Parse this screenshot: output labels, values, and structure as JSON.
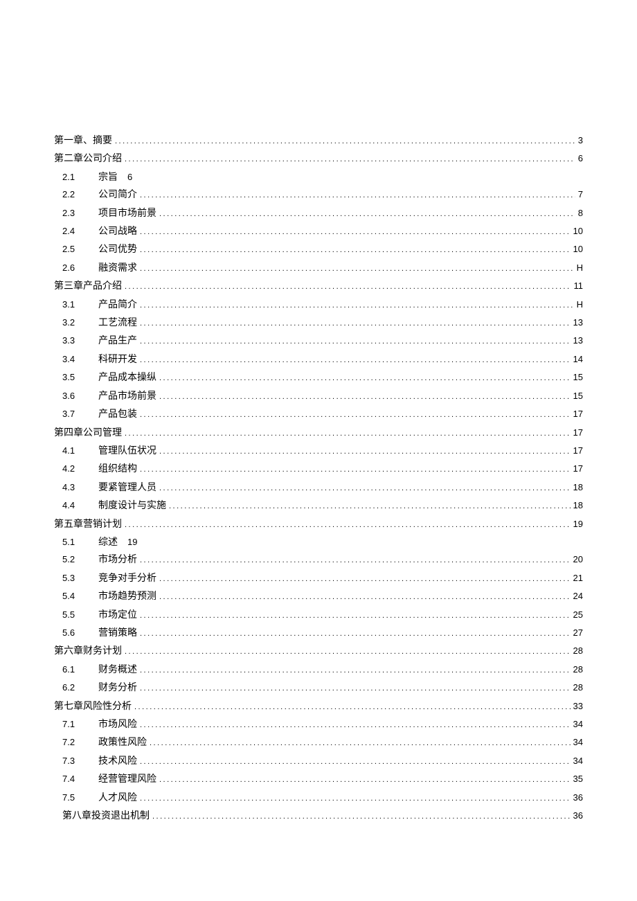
{
  "toc": [
    {
      "type": "chapter",
      "title": "第一章、摘要",
      "page": "3",
      "leader": true
    },
    {
      "type": "chapter",
      "title": "第二章公司介绍",
      "page": "6",
      "leader": true
    },
    {
      "type": "sub",
      "num": "2.1",
      "title": "宗旨",
      "page": "6",
      "leader": false
    },
    {
      "type": "sub",
      "num": "2.2",
      "title": "公司简介",
      "page": "7",
      "leader": true
    },
    {
      "type": "sub",
      "num": "2.3",
      "title": "项目市场前景",
      "page": "8",
      "leader": true
    },
    {
      "type": "sub",
      "num": "2.4",
      "title": "公司战略",
      "page": "10",
      "leader": true
    },
    {
      "type": "sub",
      "num": "2.5",
      "title": "公司优势",
      "page": "10",
      "leader": true
    },
    {
      "type": "sub",
      "num": "2.6",
      "title": "融资需求",
      "page": "H",
      "leader": true
    },
    {
      "type": "chapter",
      "title": "第三章产品介绍",
      "page": "11",
      "leader": true
    },
    {
      "type": "sub",
      "num": "3.1",
      "title": "产品简介",
      "page": "H",
      "leader": true
    },
    {
      "type": "sub",
      "num": "3.2",
      "title": "工艺流程",
      "page": "13",
      "leader": true
    },
    {
      "type": "sub",
      "num": "3.3",
      "title": "产品生产",
      "page": "13",
      "leader": true
    },
    {
      "type": "sub",
      "num": "3.4",
      "title": "科研开发",
      "page": "14",
      "leader": true
    },
    {
      "type": "sub",
      "num": "3.5",
      "title": "产品成本操纵",
      "page": "15",
      "leader": true
    },
    {
      "type": "sub",
      "num": "3.6",
      "title": "产品市场前景",
      "page": "15",
      "leader": true
    },
    {
      "type": "sub",
      "num": "3.7",
      "title": "产品包装",
      "page": "17",
      "leader": true
    },
    {
      "type": "chapter",
      "title": "第四章公司管理",
      "page": "17",
      "leader": true
    },
    {
      "type": "sub",
      "num": "4.1",
      "title": "管理队伍状况",
      "page": "17",
      "leader": true
    },
    {
      "type": "sub",
      "num": "4.2",
      "title": "组织结构",
      "page": "17",
      "leader": true
    },
    {
      "type": "sub",
      "num": "4.3",
      "title": "要紧管理人员",
      "page": "18",
      "leader": true
    },
    {
      "type": "sub",
      "num": "4.4",
      "title": "制度设计与实施",
      "page": "18",
      "leader": true
    },
    {
      "type": "chapter",
      "title": "第五章营销计划",
      "page": "19",
      "leader": true
    },
    {
      "type": "sub",
      "num": "5.1",
      "title": "综述",
      "page": "19",
      "leader": false
    },
    {
      "type": "sub",
      "num": "5.2",
      "title": "市场分析",
      "page": "20",
      "leader": true
    },
    {
      "type": "sub",
      "num": "5.3",
      "title": "竞争对手分析",
      "page": "21",
      "leader": true
    },
    {
      "type": "sub",
      "num": "5.4",
      "title": "市场趋势预测",
      "page": "24",
      "leader": true
    },
    {
      "type": "sub",
      "num": "5.5",
      "title": "市场定位",
      "page": "25",
      "leader": true
    },
    {
      "type": "sub",
      "num": "5.6",
      "title": "营销策略",
      "page": "27",
      "leader": true
    },
    {
      "type": "chapter",
      "title": "第六章财务计划",
      "page": "28",
      "leader": true
    },
    {
      "type": "sub",
      "num": "6.1",
      "title": "财务概述",
      "page": "28",
      "leader": true
    },
    {
      "type": "sub",
      "num": "6.2",
      "title": "财务分析",
      "page": "28",
      "leader": true
    },
    {
      "type": "chapter",
      "title": "第七章风险性分析",
      "page": "33",
      "leader": true
    },
    {
      "type": "sub",
      "num": "7.1",
      "title": "市场风险",
      "page": "34",
      "leader": true
    },
    {
      "type": "sub",
      "num": "7.2",
      "title": "政策性风险",
      "page": "34",
      "leader": true
    },
    {
      "type": "sub",
      "num": "7.3",
      "title": "技术风险",
      "page": "34",
      "leader": true
    },
    {
      "type": "sub",
      "num": "7.4",
      "title": "经营管理风险",
      "page": "35",
      "leader": true
    },
    {
      "type": "sub",
      "num": "7.5",
      "title": "人才风险",
      "page": "36",
      "leader": true
    },
    {
      "type": "chapter-indent",
      "title": "第八章投资退出机制",
      "page": "36",
      "leader": true
    }
  ]
}
